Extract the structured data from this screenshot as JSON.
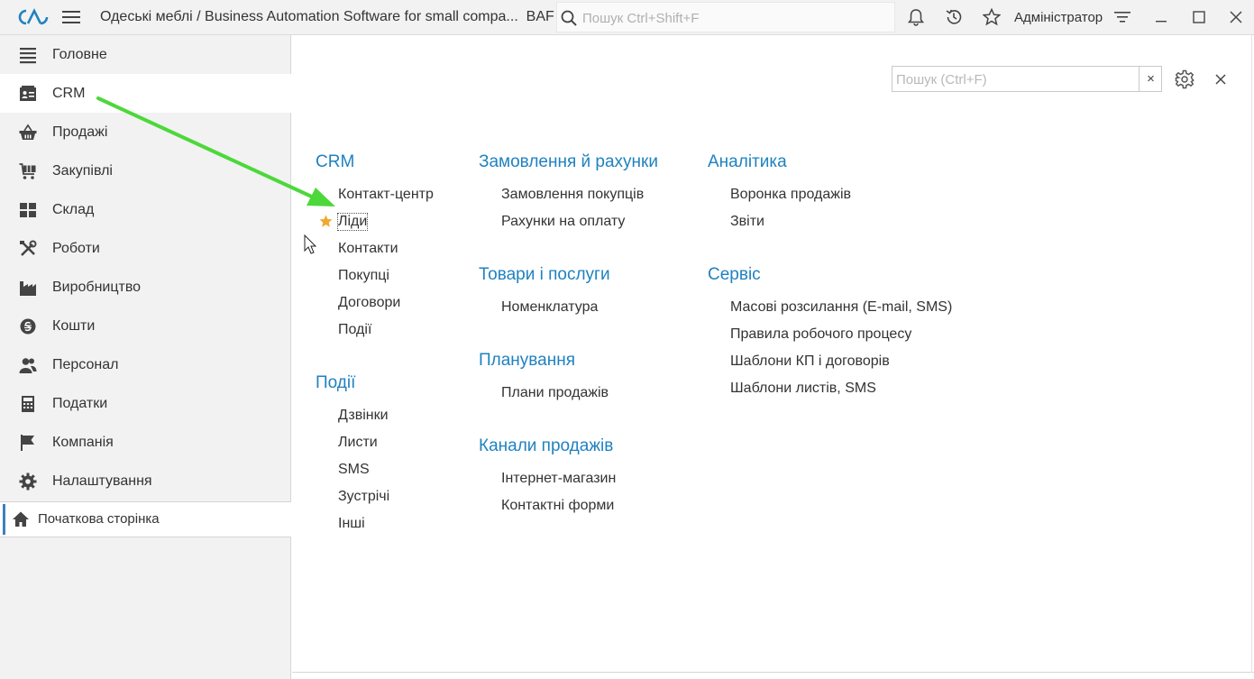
{
  "titlebar": {
    "app_title": "Одеські меблі / Business Automation Software for small compa...",
    "app_suffix": "BAF",
    "search_placeholder": "Пошук Ctrl+Shift+F",
    "user_name": "Адміністратор"
  },
  "sidebar": {
    "items": [
      {
        "label": "Головне",
        "icon": "list-icon"
      },
      {
        "label": "CRM",
        "icon": "contact-card-icon"
      },
      {
        "label": "Продажі",
        "icon": "basket-icon"
      },
      {
        "label": "Закупівлі",
        "icon": "cart-icon"
      },
      {
        "label": "Склад",
        "icon": "warehouse-grid-icon"
      },
      {
        "label": "Роботи",
        "icon": "tools-icon"
      },
      {
        "label": "Виробництво",
        "icon": "factory-icon"
      },
      {
        "label": "Кошти",
        "icon": "coin-icon"
      },
      {
        "label": "Персонал",
        "icon": "people-icon"
      },
      {
        "label": "Податки",
        "icon": "calculator-icon"
      },
      {
        "label": "Компанія",
        "icon": "flag-icon"
      },
      {
        "label": "Налаштування",
        "icon": "gear-icon"
      }
    ],
    "active_index": 1,
    "home_label": "Початкова сторінка"
  },
  "panel": {
    "search_placeholder": "Пошук (Ctrl+F)",
    "clear_symbol": "×",
    "close_symbol": "×",
    "sections": {
      "crm": {
        "title": "CRM",
        "links": [
          "Контакт-центр",
          "Ліди",
          "Контакти",
          "Покупці",
          "Договори",
          "Події"
        ]
      },
      "events": {
        "title": "Події",
        "links": [
          "Дзвінки",
          "Листи",
          "SMS",
          "Зустрічі",
          "Інші"
        ]
      },
      "orders": {
        "title": "Замовлення й рахунки",
        "links": [
          "Замовлення покупців",
          "Рахунки на оплату"
        ]
      },
      "goods": {
        "title": "Товари і послуги",
        "links": [
          "Номенклатура"
        ]
      },
      "planning": {
        "title": "Планування",
        "links": [
          "Плани продажів"
        ]
      },
      "channels": {
        "title": "Канали продажів",
        "links": [
          "Інтернет-магазин",
          "Контактні форми"
        ]
      },
      "analytics": {
        "title": "Аналітика",
        "links": [
          "Воронка продажів",
          "Звіти"
        ]
      },
      "service": {
        "title": "Сервіс",
        "links": [
          "Масові розсилання (E-mail, SMS)",
          "Правила робочого процесу",
          "Шаблони КП і договорів",
          "Шаблони листів, SMS"
        ]
      }
    }
  },
  "colors": {
    "accent": "#1f82c0",
    "arrow": "#4cd83a",
    "favorite_star": "#f0a830",
    "sidebar_bg": "#f2f2f2"
  }
}
